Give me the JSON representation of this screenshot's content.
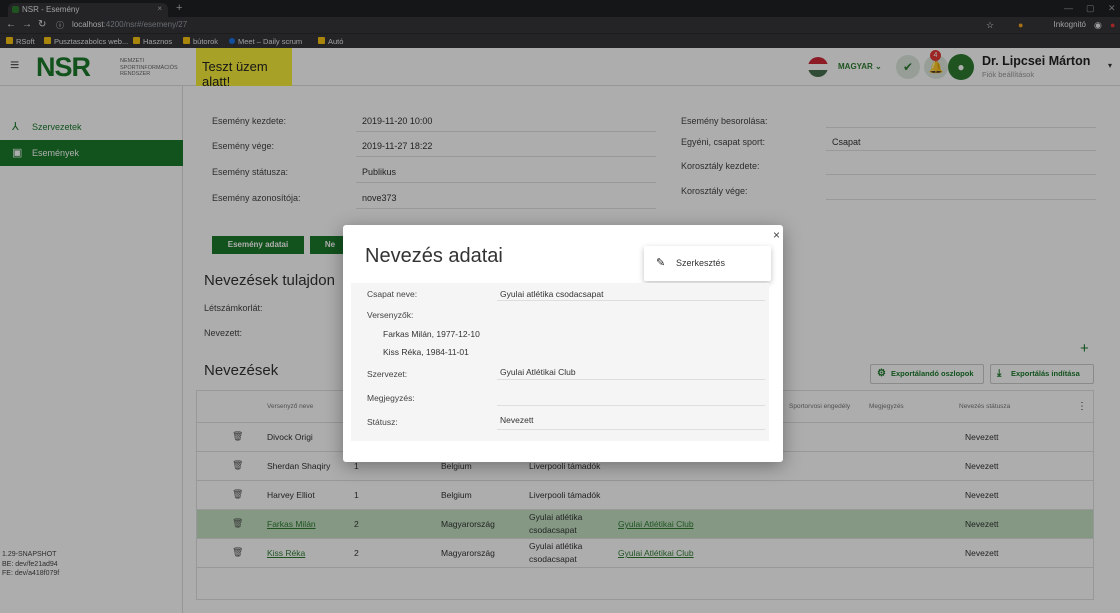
{
  "browser": {
    "tab_title": "NSR - Esemény",
    "tab_close": "×",
    "new_tab": "+",
    "url_host": "localhost",
    "url_path": ":4200/nsr#/esemeny/27",
    "mode_label": "Inkognitó",
    "bookmarks": [
      "RSoft",
      "Pusztaszabolcs web...",
      "Hasznos",
      "bútorok",
      "Meet – Daily scrum",
      "Autó"
    ]
  },
  "header": {
    "logo": "NSR",
    "logo_sub": "NEMZETI SPORTINFORMÁCIÓS RENDSZER",
    "test_badge": "Teszt üzem alatt!",
    "language": "MAGYAR",
    "notification_count": "4",
    "user_name": "Dr. Lipcsei Márton",
    "user_sub": "Fiók beállítások"
  },
  "sidebar": {
    "items": [
      {
        "label": "Szervezetek"
      },
      {
        "label": "Események"
      }
    ],
    "version_lines": [
      "1.29-SNAPSHOT",
      "BE: dev/fe21ad94",
      "FE: dev/a418f079f"
    ]
  },
  "event": {
    "left": [
      {
        "label": "Esemény kezdete:",
        "value": "2019-11-20 10:00"
      },
      {
        "label": "Esemény vége:",
        "value": "2019-11-27 18:22"
      },
      {
        "label": "Esemény státusza:",
        "value": "Publikus"
      },
      {
        "label": "Esemény azonosítója:",
        "value": "nove373"
      }
    ],
    "right": [
      {
        "label": "Esemény besorolása:",
        "value": ""
      },
      {
        "label": "Egyéni, csapat sport:",
        "value": "Csapat"
      },
      {
        "label": "Korosztály kezdete:",
        "value": ""
      },
      {
        "label": "Korosztály vége:",
        "value": ""
      }
    ]
  },
  "tabs": {
    "details": "Esemény adatai",
    "second_partial": "Ne"
  },
  "properties": {
    "title": "Nevezések tulajdon",
    "capacity_label": "Létszámkorlát:",
    "entered_label": "Nevezett:"
  },
  "entries": {
    "title": "Nevezések",
    "export_columns": "Exportálandó oszlopok",
    "export_start": "Exportálás indítása",
    "columns": [
      "Versenyző neve",
      "Sportorvosi engedély",
      "Megjegyzés",
      "Nevezés státusza"
    ],
    "rows": [
      {
        "name": "Divock Origi",
        "num": "",
        "country": "",
        "team": "",
        "org": "",
        "status": "Nevezett",
        "link": false,
        "selected": false
      },
      {
        "name": "Sherdan Shaqiry",
        "num": "1",
        "country": "Belgium",
        "team": "Liverpooli támadók",
        "org": "",
        "status": "Nevezett",
        "link": false,
        "selected": false
      },
      {
        "name": "Harvey Elliot",
        "num": "1",
        "country": "Belgium",
        "team": "Liverpooli támadók",
        "org": "",
        "status": "Nevezett",
        "link": false,
        "selected": false
      },
      {
        "name": "Farkas Milán",
        "num": "2",
        "country": "Magyarország",
        "team": "Gyulai atlétika csodacsapat",
        "org": "Gyulai Atlétikai Club",
        "status": "Nevezett",
        "link": true,
        "selected": true
      },
      {
        "name": "Kiss Réka",
        "num": "2",
        "country": "Magyarország",
        "team": "Gyulai atlétika csodacsapat",
        "org": "Gyulai Atlétikai Club",
        "status": "Nevezett",
        "link": true,
        "selected": false
      }
    ]
  },
  "modal": {
    "title": "Nevezés adatai",
    "close": "×",
    "edit_label": "Szerkesztés",
    "team_label": "Csapat neve:",
    "team_value": "Gyulai atlétika csodacsapat",
    "competitors_label": "Versenyzők:",
    "competitors": [
      "Farkas Milán, 1977-12-10",
      "Kiss Réka, 1984-11-01"
    ],
    "org_label": "Szervezet:",
    "org_value": "Gyulai Atlétikai Club",
    "note_label": "Megjegyzés:",
    "note_value": "",
    "status_label": "Státusz:",
    "status_value": "Nevezett"
  },
  "colors": {
    "brand_green": "#1b7a2b",
    "test_yellow": "#f7ee3b",
    "selected_row": "#c3e0c3"
  }
}
